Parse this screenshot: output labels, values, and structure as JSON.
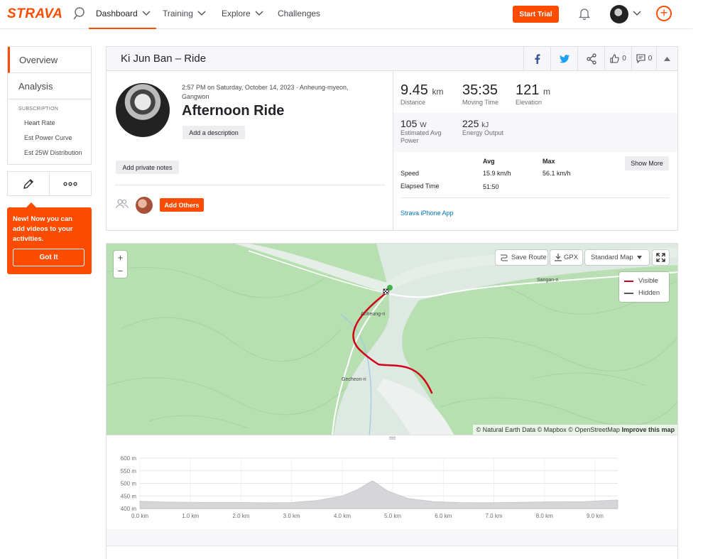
{
  "nav": {
    "logo": "STRAVA",
    "items": [
      "Dashboard",
      "Training",
      "Explore",
      "Challenges"
    ],
    "start_trial": "Start Trial"
  },
  "sidebar": {
    "overview": "Overview",
    "analysis": "Analysis",
    "subscription_title": "SUBSCRIPTION",
    "sub_items": [
      "Heart Rate",
      "Est Power Curve",
      "Est 25W Distribution"
    ]
  },
  "callout": {
    "text": "New! Now you can add videos to your activities.",
    "button": "Got It"
  },
  "header": {
    "title": "Ki Jun Ban – Ride",
    "kudos_count": "0",
    "comments_count": "0"
  },
  "activity": {
    "meta": "2:57 PM on Saturday, October 14, 2023 · Anheung-myeon, Gangwon",
    "name": "Afternoon Ride",
    "add_description": "Add a description",
    "add_private_notes": "Add private notes",
    "add_others": "Add Others"
  },
  "stats": {
    "distance": {
      "value": "9.45",
      "unit": "km",
      "label": "Distance"
    },
    "moving_time": {
      "value": "35:35",
      "label": "Moving Time"
    },
    "elevation": {
      "value": "121",
      "unit": "m",
      "label": "Elevation"
    },
    "power": {
      "value": "105",
      "unit": "W",
      "label": "Estimated Avg Power"
    },
    "energy": {
      "value": "225",
      "unit": "kJ",
      "label": "Energy Output"
    }
  },
  "table": {
    "col_avg": "Avg",
    "col_max": "Max",
    "show_more": "Show More",
    "speed_label": "Speed",
    "speed_avg": "15.9 km/h",
    "speed_max": "56.1 km/h",
    "elapsed_label": "Elapsed Time",
    "elapsed_avg": "51:50",
    "app_link": "Strava iPhone App"
  },
  "map": {
    "save_route": "Save Route",
    "gpx": "GPX",
    "map_type": "Standard Map",
    "legend_visible": "Visible",
    "legend_hidden": "Hidden",
    "zoom_in": "+",
    "zoom_out": "−",
    "places": [
      "Sangan-ri",
      "Anheung-ri",
      "Gecheon-ri"
    ],
    "attribution": "© Natural Earth Data © Mapbox © OpenStreetMap",
    "improve": "Improve this map",
    "colors": {
      "land": "#b7dfb1",
      "route": "#d0021b",
      "valley": "#dfe9e3",
      "start": "#3bb54a"
    }
  },
  "chart_data": {
    "type": "area",
    "x": [
      0.0,
      0.5,
      1.0,
      1.5,
      2.0,
      2.5,
      3.0,
      3.5,
      4.0,
      4.3,
      4.6,
      4.9,
      5.3,
      5.8,
      6.3,
      6.8,
      7.3,
      7.8,
      8.3,
      8.8,
      9.2,
      9.45
    ],
    "y": [
      429,
      426,
      425,
      424,
      424,
      423,
      424,
      432,
      450,
      475,
      510,
      470,
      440,
      428,
      424,
      423,
      424,
      426,
      427,
      428,
      432,
      434
    ],
    "ylim": [
      400,
      600
    ],
    "xlim": [
      0,
      9.45
    ],
    "yticks": [
      "400 m",
      "450 m",
      "500 m",
      "550 m",
      "600 m"
    ],
    "ytick_values": [
      400,
      450,
      500,
      550,
      600
    ],
    "xticks": [
      "0.0 km",
      "1.0 km",
      "2.0 km",
      "3.0 km",
      "4.0 km",
      "5.0 km",
      "6.0 km",
      "7.0 km",
      "8.0 km",
      "9.0 km"
    ],
    "xtick_values": [
      0,
      1,
      2,
      3,
      4,
      5,
      6,
      7,
      8,
      9
    ]
  }
}
